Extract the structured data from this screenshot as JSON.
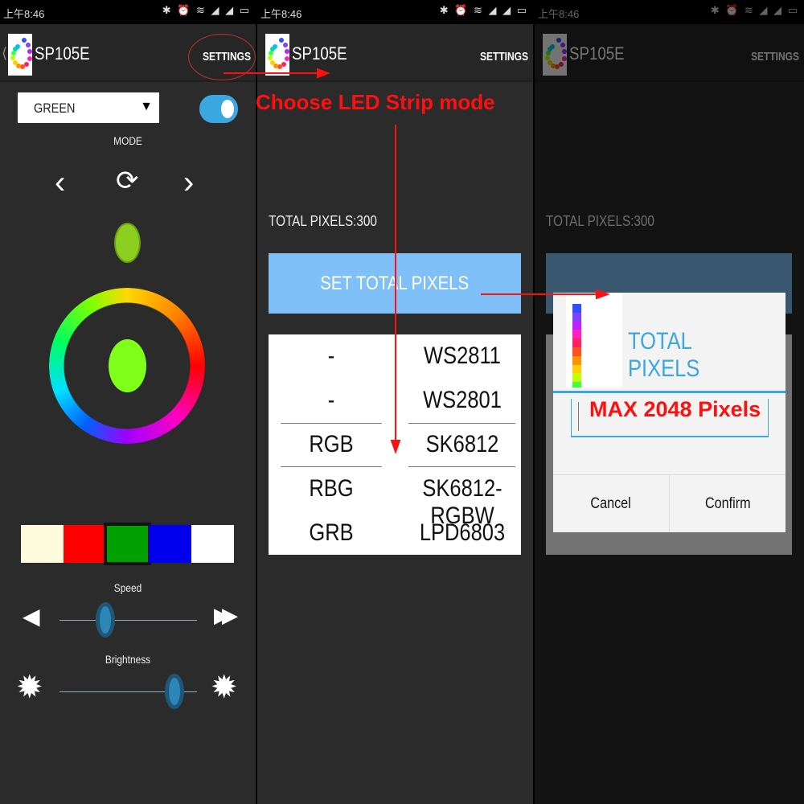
{
  "status": {
    "time": "上午8:46",
    "icons": [
      "bluetooth-icon",
      "alarm-icon",
      "wifi-icon",
      "signal-icon",
      "signal-icon",
      "battery-icon"
    ]
  },
  "app": {
    "title": "SP105E",
    "settings_label": "SETTINGS"
  },
  "panel1": {
    "color_select": "GREEN",
    "power_on": true,
    "mode_label": "MODE",
    "selected_color": "#7fff1a",
    "swatches": [
      "#fffbdc",
      "#ff0000",
      "#00a000",
      "#0000ee",
      "#ffffff"
    ],
    "selected_swatch": 2,
    "speed_label": "Speed",
    "speed_value": 0.33,
    "brightness_label": "Brightness",
    "brightness_value": 0.83
  },
  "panel2": {
    "total_pixels_label": "TOTAL PIXELS:300",
    "set_button": "SET TOTAL PIXELS",
    "color_orders": [
      "-",
      "-",
      "RGB",
      "RBG",
      "GRB"
    ],
    "chip_types": [
      "WS2811",
      "WS2801",
      "SK6812",
      "SK6812-RGBW",
      "LPD6803"
    ]
  },
  "dialog": {
    "title": "TOTAL PIXELS",
    "cancel": "Cancel",
    "confirm": "Confirm"
  },
  "annotations": {
    "choose_mode": "Choose LED Strip mode",
    "max_pixels": "MAX 2048 Pixels"
  },
  "colors": {
    "accent": "#3aa7e0",
    "button": "#80c0f8",
    "annotation": "#ff1010"
  }
}
